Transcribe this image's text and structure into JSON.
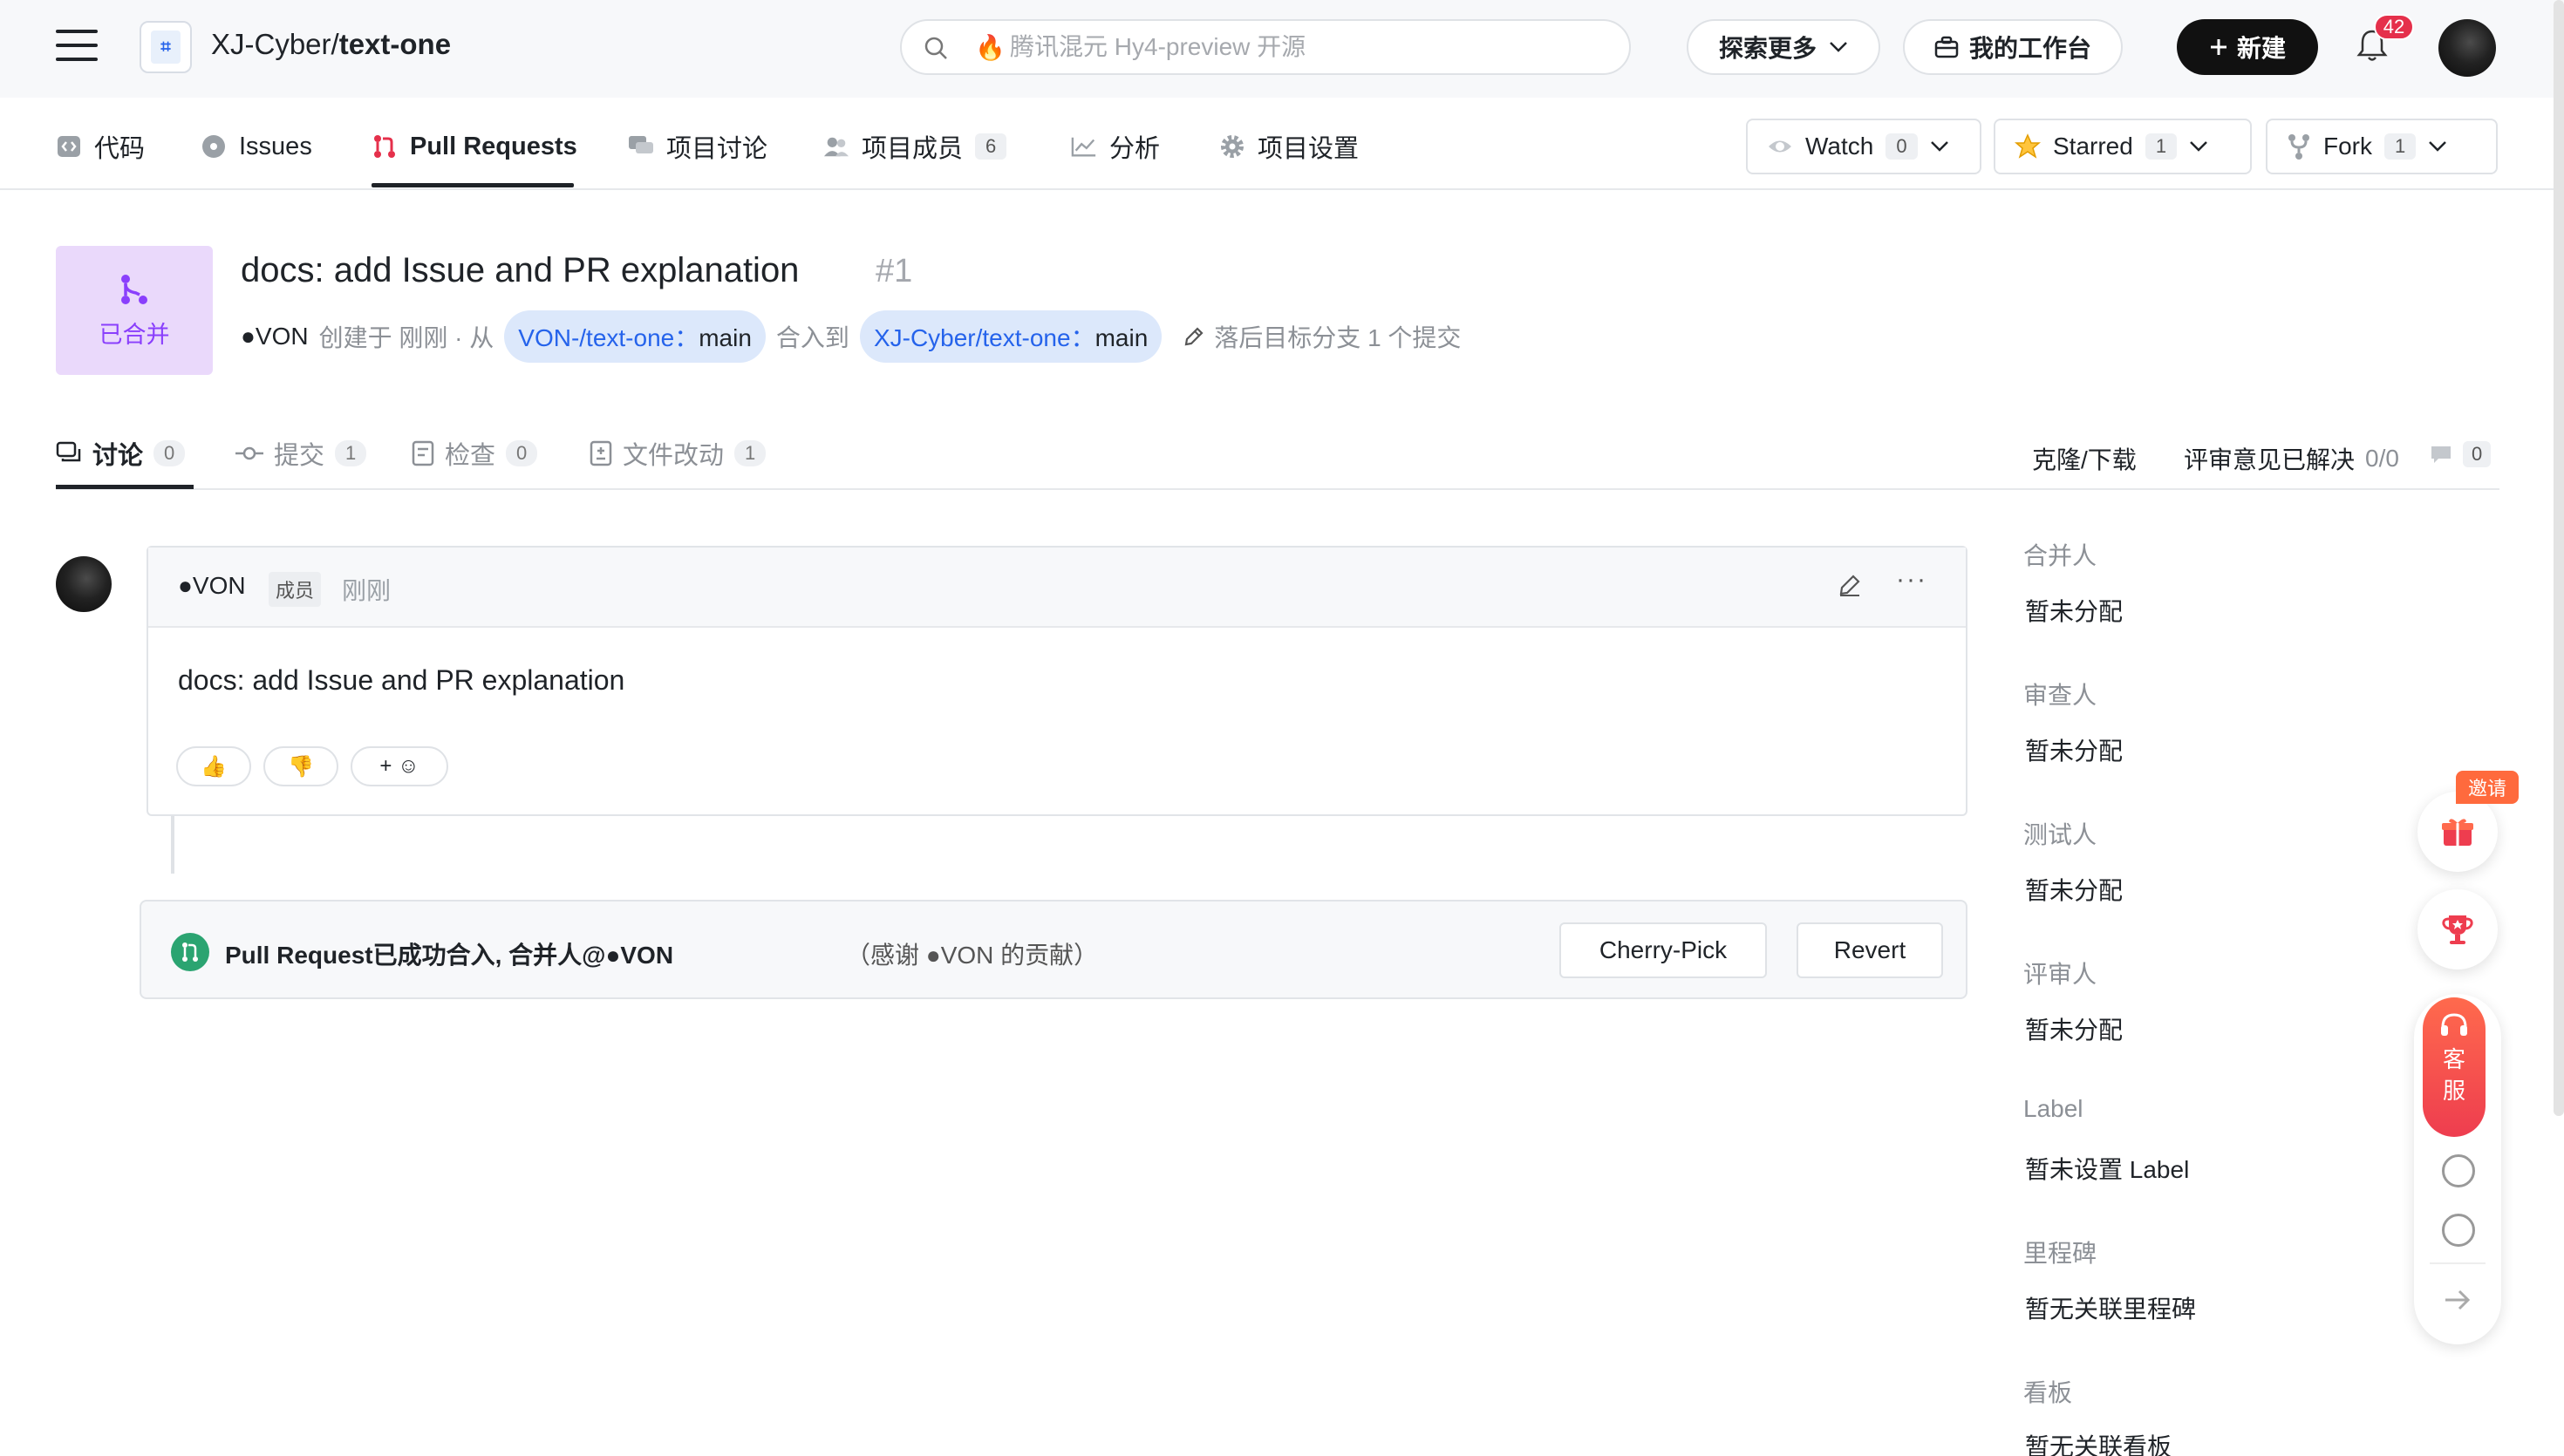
{
  "header": {
    "repo_owner": "XJ-Cyber/",
    "repo_name": "text-one",
    "search_placeholder": "腾讯混元 Hy4-preview 开源",
    "explore_label": "探索更多",
    "workbench_label": "我的工作台",
    "new_label": "新建",
    "notification_count": "42"
  },
  "repo_nav": {
    "items": [
      {
        "label": "代码",
        "icon": "code-icon"
      },
      {
        "label": "Issues",
        "icon": "issue-icon"
      },
      {
        "label": "Pull Requests",
        "icon": "pull-request-icon"
      },
      {
        "label": "项目讨论",
        "icon": "discussion-icon"
      },
      {
        "label": "项目成员",
        "icon": "members-icon",
        "count": "6"
      },
      {
        "label": "分析",
        "icon": "chart-icon"
      },
      {
        "label": "项目设置",
        "icon": "settings-icon"
      }
    ],
    "watch": {
      "label": "Watch",
      "count": "0"
    },
    "star": {
      "label": "Starred",
      "count": "1"
    },
    "fork": {
      "label": "Fork",
      "count": "1"
    }
  },
  "pr": {
    "state": "已合并",
    "title": "docs: add Issue and PR explanation",
    "number": "#1",
    "author": "●VON",
    "created": "创建于 刚刚 · 从",
    "source_branch_repo": "VON-/text-one：",
    "source_branch": "main",
    "merge_into": "合入到",
    "target_branch_repo": "XJ-Cyber/text-one：",
    "target_branch": "main",
    "behind": "落后目标分支 1 个提交"
  },
  "tabs": {
    "items": [
      {
        "label": "讨论",
        "count": "0"
      },
      {
        "label": "提交",
        "count": "1"
      },
      {
        "label": "检查",
        "count": "0"
      },
      {
        "label": "文件改动",
        "count": "1"
      }
    ],
    "clone": "克隆/下载",
    "review_resolved": "评审意见已解决",
    "review_ratio": "0/0",
    "comment_count": "0"
  },
  "comment": {
    "author": "●VON",
    "role": "成员",
    "time": "刚刚",
    "body": "docs: add Issue and PR explanation",
    "reactions": [
      "👍",
      "👎",
      "+ ☺"
    ]
  },
  "merged": {
    "text": "Pull Request已成功合入, 合并人@●VON",
    "thanks": "（感谢 ●VON 的贡献）",
    "cherry_pick": "Cherry-Pick",
    "revert": "Revert"
  },
  "sidebar": {
    "sections": [
      {
        "label": "合并人",
        "value": "暂未分配"
      },
      {
        "label": "审查人",
        "value": "暂未分配"
      },
      {
        "label": "测试人",
        "value": "暂未分配"
      },
      {
        "label": "评审人",
        "value": "暂未分配"
      },
      {
        "label": "Label",
        "value": "暂未设置 Label"
      },
      {
        "label": "里程碑",
        "value": "暂无关联里程碑"
      },
      {
        "label": "看板",
        "value": "暂无关联看板"
      }
    ]
  },
  "floating": {
    "invite": "邀请",
    "kefu_1": "客",
    "kefu_2": "服"
  },
  "colors": {
    "merged_purple": "#8a3ffc",
    "merged_bg": "#ead9fb",
    "branch_blue": "#2563eb",
    "success_green": "#2ba471",
    "notify_red": "#e5304b"
  }
}
